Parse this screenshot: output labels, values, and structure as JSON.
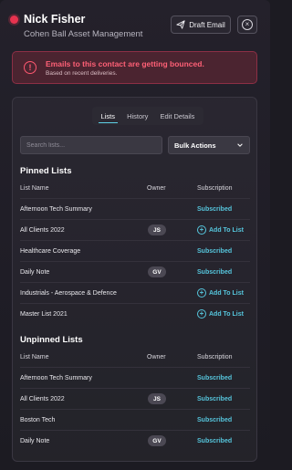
{
  "header": {
    "name": "Nick Fisher",
    "company": "Cohen Ball Asset Management",
    "draft_email_label": "Draft Email",
    "close_glyph": "×"
  },
  "alert": {
    "icon_glyph": "!",
    "title": "Emails to this contact are getting bounced.",
    "subtitle": "Based on recent deliveries."
  },
  "tabs": [
    {
      "label": "Lists",
      "active": true
    },
    {
      "label": "History",
      "active": false
    },
    {
      "label": "Edit Details",
      "active": false
    }
  ],
  "search": {
    "placeholder": "Search lists..."
  },
  "bulk_actions": {
    "label": "Bulk Actions"
  },
  "columns": {
    "name": "List Name",
    "owner": "Owner",
    "subscription": "Subscription"
  },
  "pinned": {
    "title": "Pinned Lists",
    "rows": [
      {
        "name": "Afternoon Tech Summary",
        "owner": "",
        "status": "Subscribed"
      },
      {
        "name": "All Clients 2022",
        "owner": "JS",
        "status": "Add To List"
      },
      {
        "name": "Healthcare Coverage",
        "owner": "",
        "status": "Subscribed"
      },
      {
        "name": "Daily Note",
        "owner": "GV",
        "status": "Subscribed"
      },
      {
        "name": "Industrials - Aerospace & Defence",
        "owner": "",
        "status": "Add To List"
      },
      {
        "name": "Master List 2021",
        "owner": "",
        "status": "Add To List"
      }
    ]
  },
  "unpinned": {
    "title": "Unpinned Lists",
    "rows": [
      {
        "name": "Afternoon Tech Summary",
        "owner": "",
        "status": "Subscribed"
      },
      {
        "name": "All Clients 2022",
        "owner": "JS",
        "status": "Subscribed"
      },
      {
        "name": "Boston Tech",
        "owner": "",
        "status": "Subscribed"
      },
      {
        "name": "Daily Note",
        "owner": "GV",
        "status": "Subscribed"
      }
    ]
  },
  "colors": {
    "accent": "#56c6dd",
    "alert": "#ff6076",
    "status_dot": "#e8334f"
  },
  "icons": {
    "draft": "send-icon",
    "close": "close-circle-icon",
    "alert": "alert-circle-icon",
    "dropdown": "chevron-down-icon",
    "add": "plus-circle-icon"
  }
}
